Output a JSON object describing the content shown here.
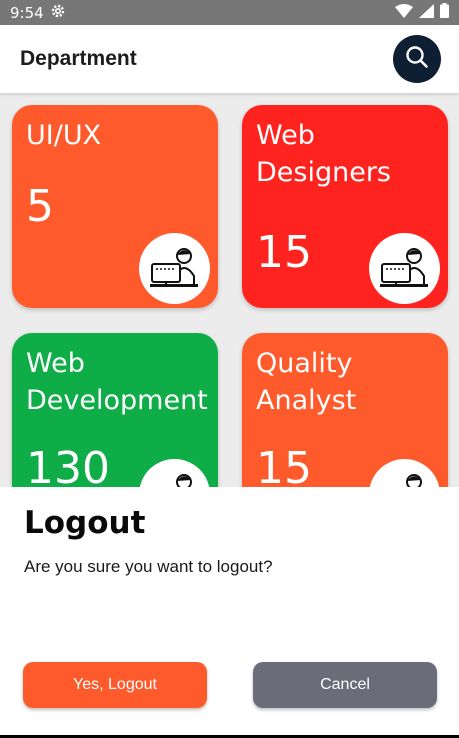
{
  "status_bar": {
    "time": "9:54"
  },
  "appbar": {
    "title": "Department"
  },
  "departments": [
    {
      "title": "UI/UX",
      "count": "5",
      "color": "#ff5a2c"
    },
    {
      "title": "Web Designers",
      "count": "15",
      "color": "#ff231f"
    },
    {
      "title": "Web Development",
      "count": "130",
      "color": "#0ead48"
    },
    {
      "title": "Quality Analyst",
      "count": "15",
      "color": "#ff5a2c"
    }
  ],
  "dialog": {
    "title": "Logout",
    "message": "Are you sure you want to logout?",
    "confirm_label": "Yes, Logout",
    "cancel_label": "Cancel"
  },
  "colors": {
    "accent": "#ff5a2c",
    "search_bg": "#0e1f33",
    "cancel_bg": "#6a6c7a"
  },
  "icons": [
    "gear-icon",
    "wifi-icon",
    "signal-icon",
    "battery-icon",
    "search-icon",
    "developer-icon"
  ]
}
